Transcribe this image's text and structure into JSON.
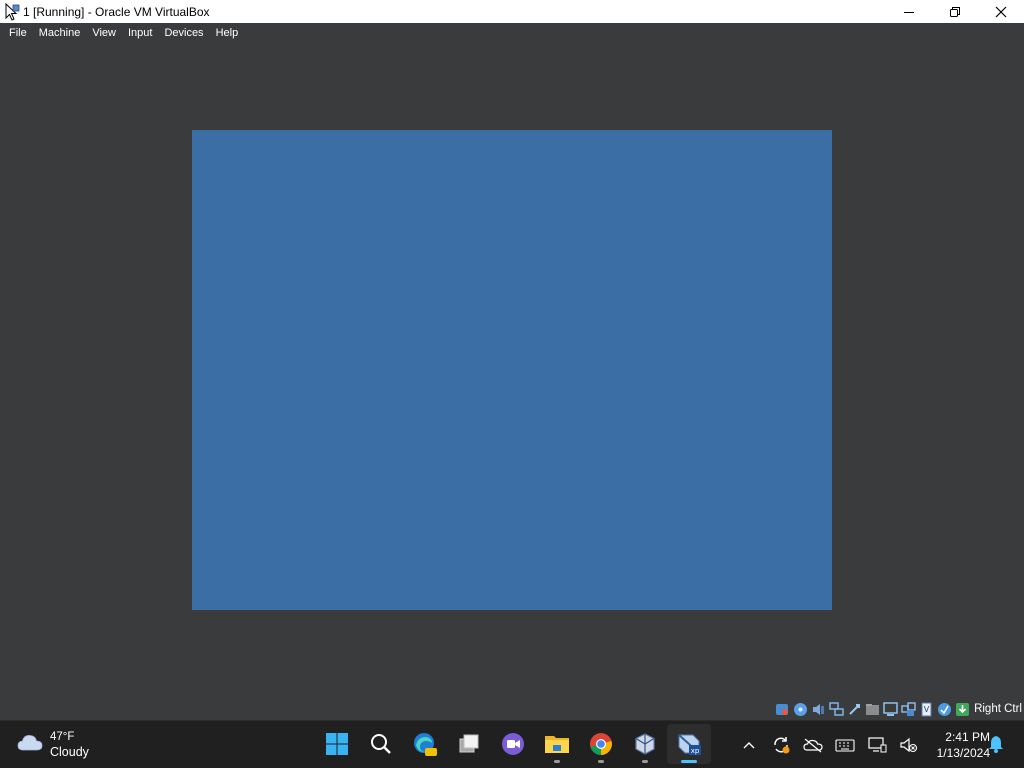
{
  "window": {
    "title": "1 [Running] - Oracle VM VirtualBox",
    "controls": [
      "minimize",
      "maximize",
      "close"
    ]
  },
  "menu": {
    "items": [
      "File",
      "Machine",
      "View",
      "Input",
      "Devices",
      "Help"
    ]
  },
  "vm_display": {
    "background_color": "#3b6ea5"
  },
  "status_bar": {
    "icons": [
      "hard-disk-icon",
      "optical-drive-icon",
      "audio-icon",
      "network-icon",
      "usb-icon",
      "shared-folders-icon",
      "display-icon",
      "video-capture-icon",
      "cpu-icon",
      "mouse-integration-icon",
      "keyboard-icon"
    ],
    "host_key_label": "Right Ctrl"
  },
  "taskbar": {
    "weather": {
      "temperature": "47°F",
      "condition": "Cloudy"
    },
    "apps": [
      {
        "name": "Start",
        "icon": "windows-start-icon",
        "running": false
      },
      {
        "name": "Search",
        "icon": "search-icon",
        "running": false
      },
      {
        "name": "Microsoft Edge Beta",
        "icon": "edge-beta-icon",
        "running": false
      },
      {
        "name": "Task View",
        "icon": "task-view-icon",
        "running": false
      },
      {
        "name": "Clipchamp",
        "icon": "clipchamp-icon",
        "running": false
      },
      {
        "name": "File Explorer",
        "icon": "file-explorer-icon",
        "running": true
      },
      {
        "name": "Google Chrome",
        "icon": "chrome-icon",
        "running": true
      },
      {
        "name": "Oracle VM VirtualBox",
        "icon": "virtualbox-icon",
        "running": true
      },
      {
        "name": "VM 1 - Windows XP",
        "icon": "windows-xp-vm-icon",
        "running": true,
        "active": true
      }
    ],
    "tray_icons": [
      "chevron-up-icon",
      "sync-icon",
      "onedrive-icon",
      "keyboard-icon",
      "network-icon",
      "volume-muted-icon"
    ],
    "clock": {
      "time": "2:41 PM",
      "date": "1/13/2024"
    }
  },
  "colors": {
    "title_bar": "#ffffff",
    "window_background": "#3a3b3d",
    "taskbar": "#202020",
    "accent": "#4cc2ff"
  }
}
